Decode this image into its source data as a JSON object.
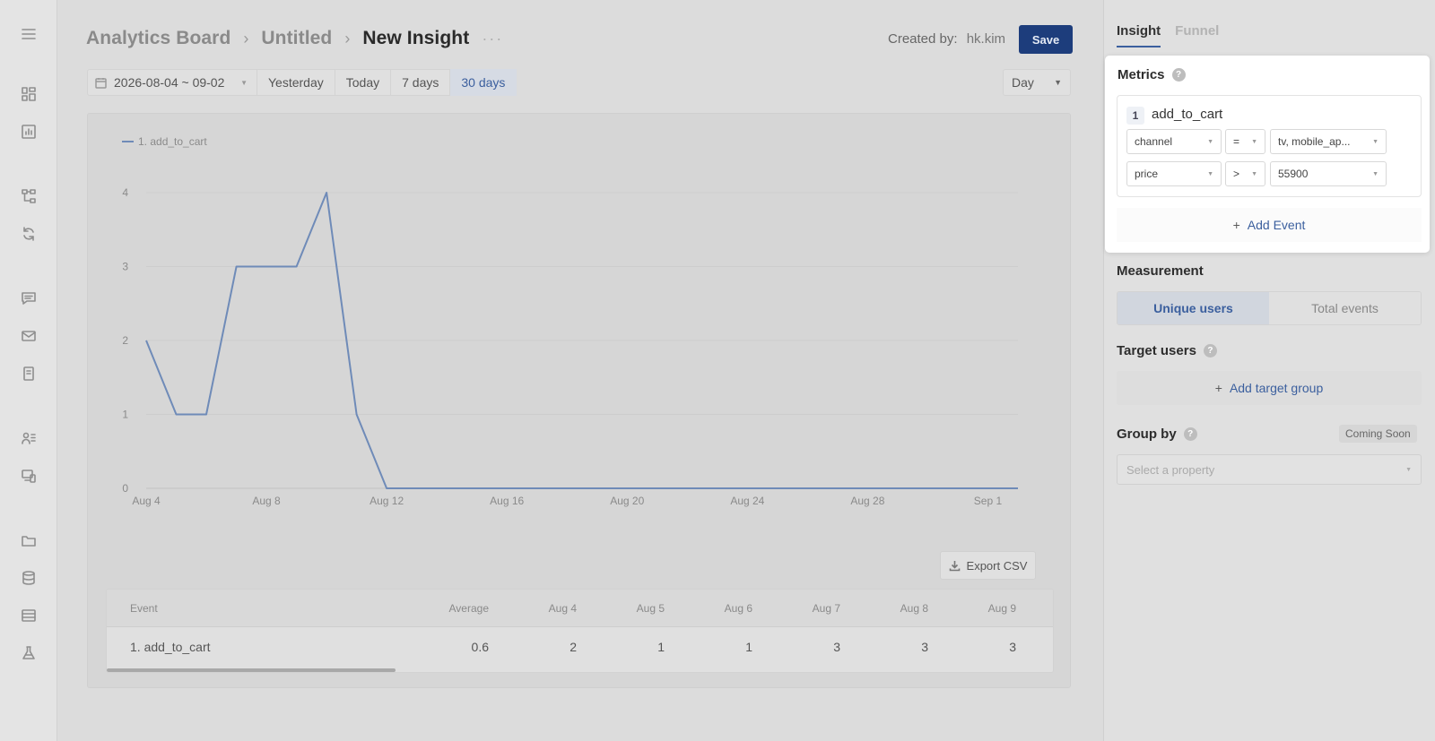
{
  "rail": {
    "icons": [
      "menu-icon",
      "dashboard-icon",
      "report-icon",
      "flow-icon",
      "refresh-icon",
      "message-icon",
      "mail-icon",
      "document-icon",
      "users-list-icon",
      "devices-icon",
      "folder-icon",
      "database-icon",
      "table-icon",
      "flask-icon"
    ]
  },
  "breadcrumb": {
    "item1": "Analytics Board",
    "item2": "Untitled",
    "current": "New Insight",
    "sep": "›",
    "more": "···"
  },
  "created_by": {
    "label": "Created by:",
    "user": "hk.kim"
  },
  "save_label": "Save",
  "toolbar": {
    "date_range": "2026-08-04 ~ 09-02",
    "ranges": [
      "Yesterday",
      "Today",
      "7 days",
      "30 days"
    ],
    "active_range": "30 days",
    "interval": "Day"
  },
  "chart_data": {
    "type": "line",
    "series": [
      {
        "name": "1. add_to_cart",
        "values": [
          2,
          1,
          1,
          3,
          3,
          3,
          4,
          1,
          0,
          0,
          0,
          0,
          0,
          0,
          0,
          0,
          0,
          0,
          0,
          0,
          0,
          0,
          0,
          0,
          0,
          0,
          0,
          0,
          0,
          0
        ]
      }
    ],
    "x_ticks": [
      "Aug 4",
      "Aug 8",
      "Aug 12",
      "Aug 16",
      "Aug 20",
      "Aug 24",
      "Aug 28",
      "Sep 1"
    ],
    "y_ticks": [
      "0",
      "1",
      "2",
      "3",
      "4"
    ],
    "ylim": [
      0,
      4
    ],
    "grid": true,
    "legend": "top-left",
    "color": "#6f8bb8"
  },
  "export_label": "Export CSV",
  "table": {
    "headers": [
      "Event",
      "Average",
      "Aug 4",
      "Aug 5",
      "Aug 6",
      "Aug 7",
      "Aug 8",
      "Aug 9"
    ],
    "row": [
      "1. add_to_cart",
      "0.6",
      "2",
      "1",
      "1",
      "3",
      "3",
      "3"
    ]
  },
  "panel": {
    "tabs": [
      "Insight",
      "Funnel"
    ],
    "metrics_title": "Metrics",
    "help": "?",
    "event": {
      "index": "1",
      "name": "add_to_cart",
      "filters": [
        {
          "property": "channel",
          "operator": "=",
          "value": "tv, mobile_ap..."
        },
        {
          "property": "price",
          "operator": ">",
          "value": "55900"
        }
      ]
    },
    "add_event": "Add Event",
    "measurement_title": "Measurement",
    "measurement_options": [
      "Unique users",
      "Total events"
    ],
    "target_title": "Target users",
    "add_target": "Add target group",
    "group_title": "Group by",
    "coming_soon": "Coming Soon",
    "property_placeholder": "Select a property",
    "plus": "+"
  }
}
